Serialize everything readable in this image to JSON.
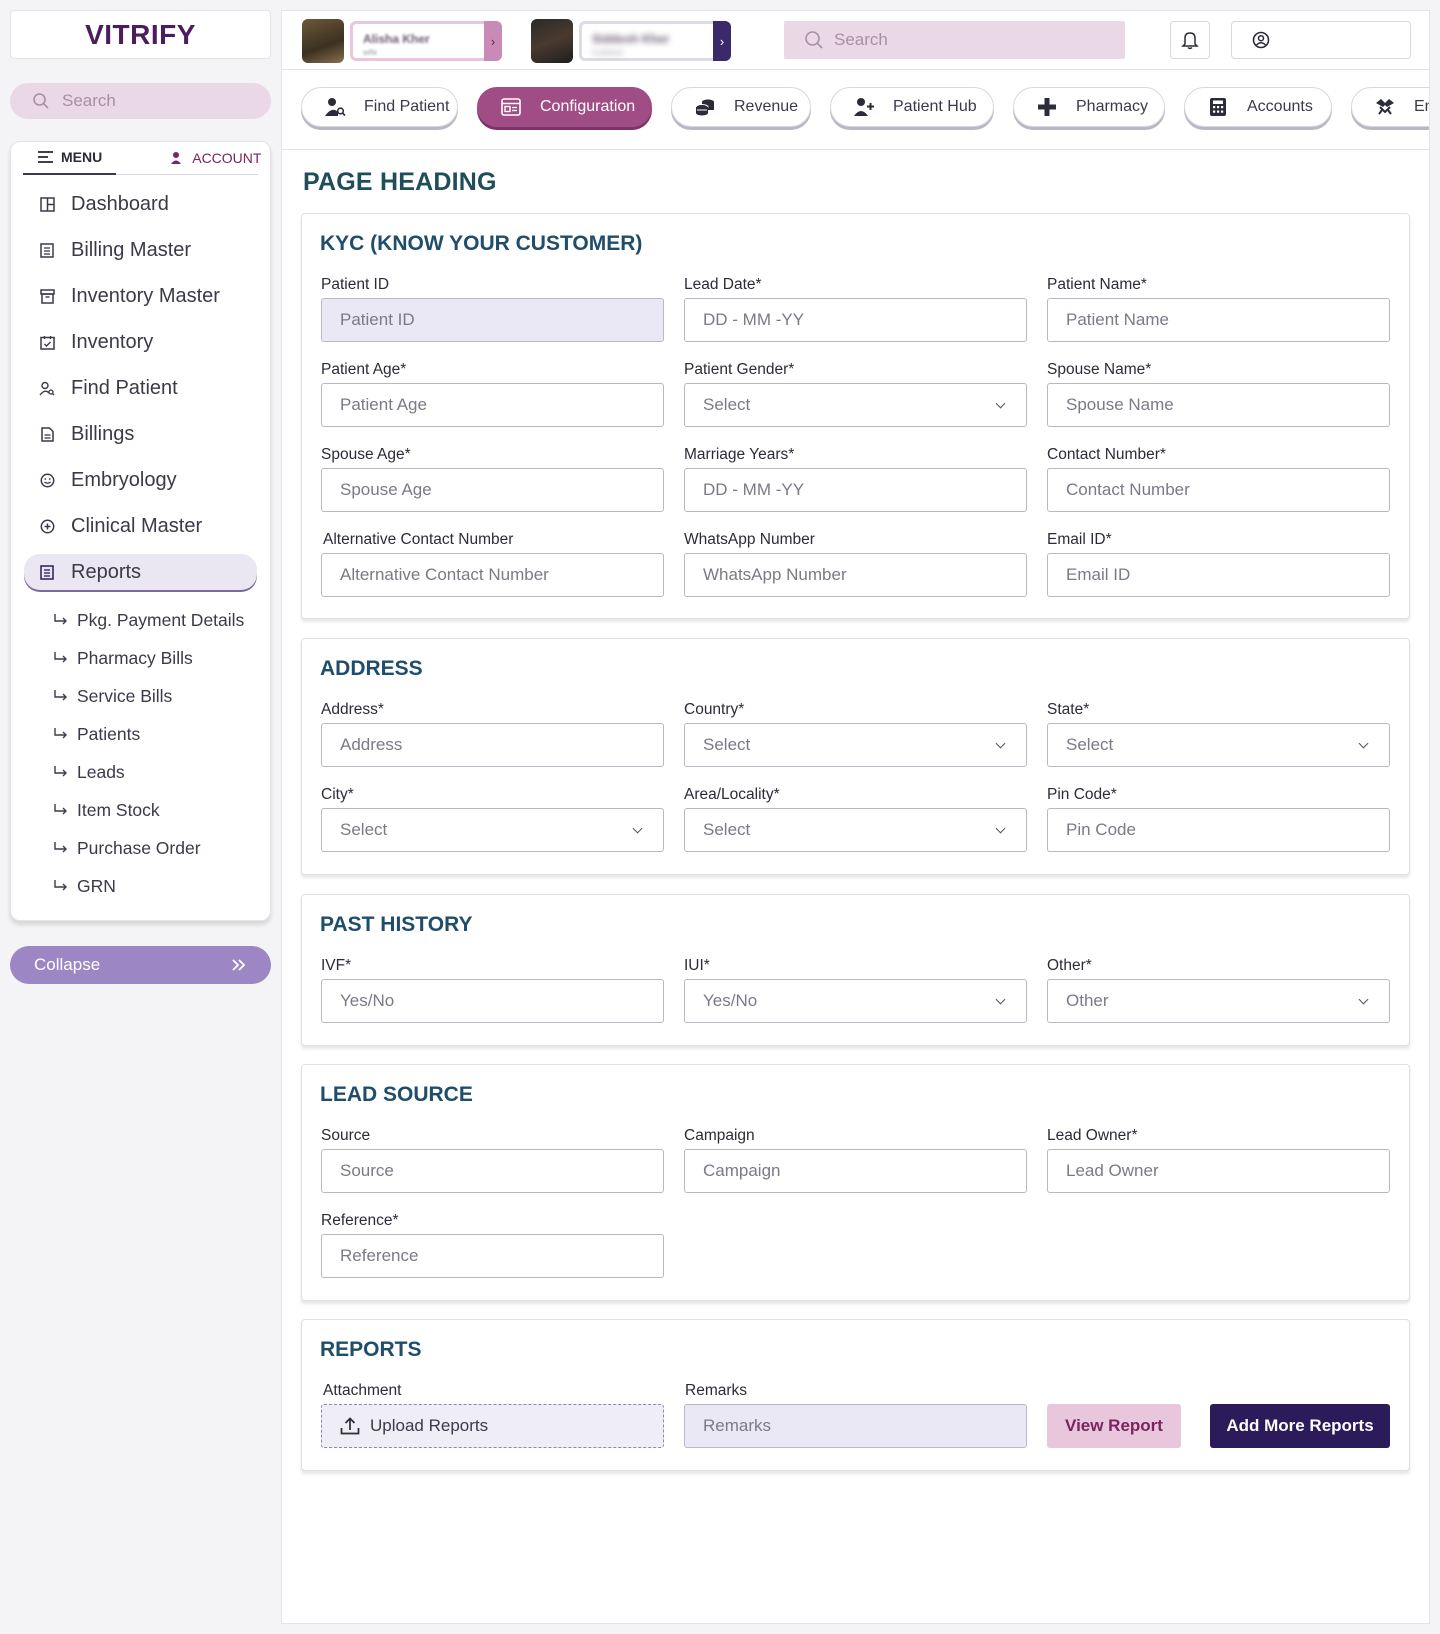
{
  "brand": {
    "logo_text": "VITRIFY"
  },
  "sidebar": {
    "search_placeholder": "Search",
    "tab_menu": "MENU",
    "tab_account": "ACCOUNT",
    "items": [
      {
        "label": "Dashboard",
        "icon": "grid-icon"
      },
      {
        "label": "Billing Master",
        "icon": "list-icon"
      },
      {
        "label": "Inventory Master",
        "icon": "archive-icon"
      },
      {
        "label": "Inventory",
        "icon": "calendar-check-icon"
      },
      {
        "label": "Find Patient",
        "icon": "user-search-icon"
      },
      {
        "label": "Billings",
        "icon": "document-icon"
      },
      {
        "label": "Embryology",
        "icon": "smile-circle-icon"
      },
      {
        "label": "Clinical Master",
        "icon": "plus-circle-icon"
      },
      {
        "label": "Reports",
        "icon": "report-icon",
        "active": true
      }
    ],
    "sub_items": [
      "Pkg. Payment Details",
      "Pharmacy Bills",
      "Service Bills",
      "Patients",
      "Leads",
      "Item Stock",
      "Purchase Order",
      "GRN"
    ],
    "collapse_label": "Collapse"
  },
  "topbar": {
    "patients": [
      {
        "name": "Alisha Kher",
        "sub": "wife"
      },
      {
        "name": "Siddesh Kher",
        "sub": "husband"
      }
    ],
    "search_placeholder": "Search"
  },
  "modules": [
    {
      "label": "Find Patient",
      "icon": "user-search-icon"
    },
    {
      "label": "Configuration",
      "icon": "config-icon",
      "active": true
    },
    {
      "label": "Revenue",
      "icon": "coins-icon"
    },
    {
      "label": "Patient Hub",
      "icon": "user-add-icon"
    },
    {
      "label": "Pharmacy",
      "icon": "medical-cross-icon"
    },
    {
      "label": "Accounts",
      "icon": "calculator-icon"
    },
    {
      "label": "Em",
      "icon": "handshake-icon"
    }
  ],
  "page": {
    "heading": "PAGE HEADING"
  },
  "kyc": {
    "title": "KYC (KNOW YOUR CUSTOMER)",
    "fields": [
      {
        "label": "Patient ID",
        "placeholder": "Patient ID",
        "type": "readonly"
      },
      {
        "label": "Lead Date*",
        "placeholder": "DD - MM -YY",
        "type": "text"
      },
      {
        "label": "Patient Name*",
        "placeholder": "Patient Name",
        "type": "text"
      },
      {
        "label": "Patient Age*",
        "placeholder": "Patient Age",
        "type": "text"
      },
      {
        "label": "Patient Gender*",
        "placeholder": "Select",
        "type": "select"
      },
      {
        "label": "Spouse Name*",
        "placeholder": "Spouse Name",
        "type": "text"
      },
      {
        "label": "Spouse Age*",
        "placeholder": "Spouse Age",
        "type": "text"
      },
      {
        "label": "Marriage Years*",
        "placeholder": "DD - MM -YY",
        "type": "text"
      },
      {
        "label": "Contact Number*",
        "placeholder": "Contact Number",
        "type": "text"
      },
      {
        "label": "Alternative Contact Number",
        "placeholder": "Alternative Contact Number",
        "type": "text"
      },
      {
        "label": "WhatsApp Number",
        "placeholder": "WhatsApp Number",
        "type": "text"
      },
      {
        "label": "Email ID*",
        "placeholder": "Email ID",
        "type": "text"
      }
    ]
  },
  "address": {
    "title": "ADDRESS",
    "fields": [
      {
        "label": "Address*",
        "placeholder": "Address",
        "type": "text"
      },
      {
        "label": "Country*",
        "placeholder": "Select",
        "type": "select"
      },
      {
        "label": "State*",
        "placeholder": "Select",
        "type": "select"
      },
      {
        "label": "City*",
        "placeholder": "Select",
        "type": "select"
      },
      {
        "label": "Area/Locality*",
        "placeholder": "Select",
        "type": "select"
      },
      {
        "label": "Pin Code*",
        "placeholder": "Pin Code",
        "type": "text"
      }
    ]
  },
  "past_history": {
    "title": "PAST HISTORY",
    "fields": [
      {
        "label": "IVF*",
        "placeholder": "Yes/No",
        "type": "text"
      },
      {
        "label": "IUI*",
        "placeholder": "Yes/No",
        "type": "select"
      },
      {
        "label": "Other*",
        "placeholder": "Other",
        "type": "select"
      }
    ]
  },
  "lead_source": {
    "title": "LEAD SOURCE",
    "fields": [
      {
        "label": "Source",
        "placeholder": "Source",
        "type": "text"
      },
      {
        "label": "Campaign",
        "placeholder": "Campaign",
        "type": "text"
      },
      {
        "label": "Lead Owner*",
        "placeholder": "Lead Owner",
        "type": "text"
      },
      {
        "label": "Reference*",
        "placeholder": "Reference",
        "type": "text"
      }
    ]
  },
  "reports": {
    "title": "REPORTS",
    "attachment_label": "Attachment",
    "upload_label": "Upload Reports",
    "remarks_label": "Remarks",
    "remarks_placeholder": "Remarks",
    "view_button": "View Report",
    "add_button": "Add More Reports"
  },
  "colors": {
    "brand": "#4b1d5e",
    "accent_active": "#a04d86",
    "primary_button": "#2c1b5a",
    "secondary_button": "#e8c6dc",
    "heading": "#1f4d5a"
  }
}
